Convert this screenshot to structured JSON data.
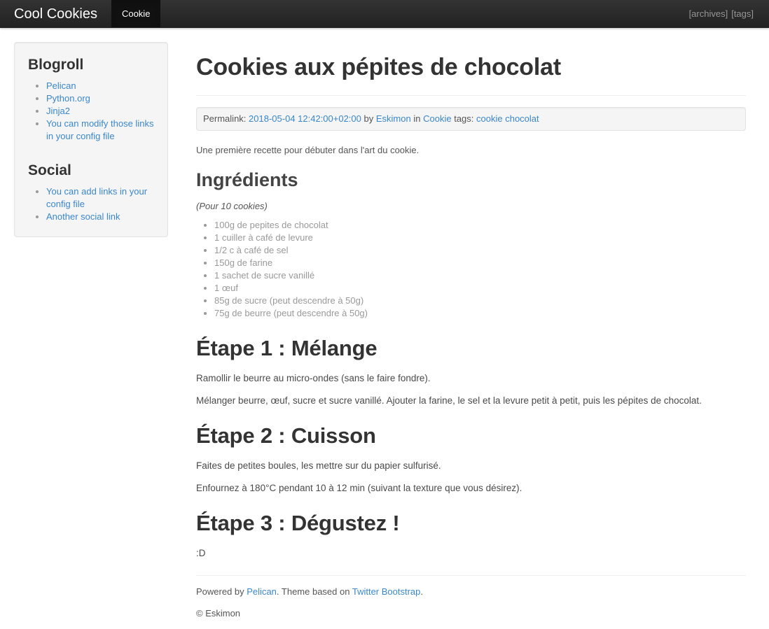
{
  "navbar": {
    "brand": "Cool Cookies",
    "items": [
      {
        "label": "Cookie",
        "active": true
      }
    ],
    "right_links": [
      {
        "label": "[archives]"
      },
      {
        "label": "[tags]"
      }
    ]
  },
  "sidebar": {
    "sections": [
      {
        "title": "Blogroll",
        "links": [
          "Pelican",
          "Python.org",
          "Jinja2",
          "You can modify those links in your config file"
        ]
      },
      {
        "title": "Social",
        "links": [
          "You can add links in your config file",
          "Another social link"
        ]
      }
    ]
  },
  "article": {
    "title": "Cookies aux pépites de chocolat",
    "meta": {
      "permalink_label": "Permalink:",
      "date": "2018-05-04 12:42:00+02:00",
      "by_label": "by",
      "author": "Eskimon",
      "in_label": "in",
      "category": "Cookie",
      "tags_label": "tags:",
      "tags": [
        "cookie",
        "chocolat"
      ]
    },
    "intro": "Une première recette pour débuter dans l'art du cookie.",
    "ingredients_heading": "Ingrédients",
    "serves": "(Pour 10 cookies)",
    "ingredients": [
      "100g de pepites de chocolat",
      "1 cuiller à café de levure",
      "1/2 c à café de sel",
      "150g de farine",
      "1 sachet de sucre vanillé",
      "1 œuf",
      "85g de sucre (peut descendre à 50g)",
      "75g de beurre (peut descendre à 50g)"
    ],
    "steps": [
      {
        "heading": "Étape 1 : Mélange",
        "paragraphs": [
          "Ramollir le beurre au micro-ondes (sans le faire fondre).",
          "Mélanger beurre, œuf, sucre et sucre vanillé. Ajouter la farine, le sel et la levure petit à petit, puis les pépites de chocolat."
        ]
      },
      {
        "heading": "Étape 2 : Cuisson",
        "paragraphs": [
          "Faites de petites boules, les mettre sur du papier sulfurisé.",
          "Enfournez à 180°C pendant 10 à 12 min (suivant la texture que vous désirez)."
        ]
      },
      {
        "heading": "Étape 3 : Dégustez !",
        "paragraphs": [
          ":D"
        ]
      }
    ]
  },
  "footer": {
    "powered_prefix": "Powered by ",
    "pelican_link": "Pelican",
    "theme_middle": ". Theme based on ",
    "bootstrap_link": "Twitter Bootstrap",
    "period": ".",
    "copyright": "© Eskimon"
  },
  "colors": {
    "navbar_bg": "#222222",
    "navbar_active_bg": "#111111",
    "link": "#3a87cd",
    "muted": "#999999",
    "well_bg": "#f5f5f5",
    "well_border": "#e3e3e3"
  }
}
